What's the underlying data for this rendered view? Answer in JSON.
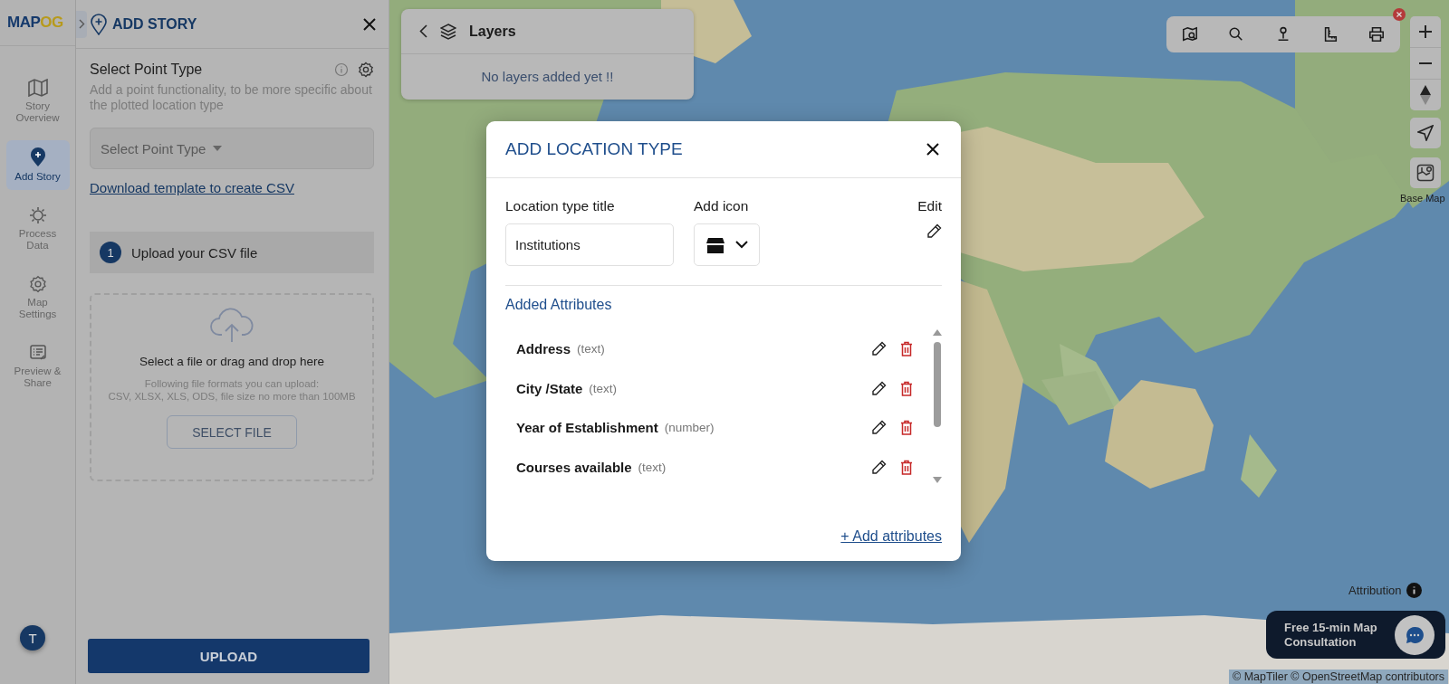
{
  "logo": {
    "text_1": "MAP",
    "text_2": "OG"
  },
  "nav": [
    {
      "kind": "map",
      "label": "Story Overview",
      "selected": false
    },
    {
      "kind": "pin",
      "label": "Add Story",
      "selected": true
    },
    {
      "kind": "gear-data",
      "label": "Process Data",
      "selected": false
    },
    {
      "kind": "settings",
      "label": "Map Settings",
      "selected": false
    },
    {
      "kind": "preview",
      "label": "Preview & Share",
      "selected": false
    }
  ],
  "avatar": "T",
  "panel": {
    "title": "ADD STORY",
    "section_title": "Select Point Type",
    "description": "Add a point functionality, to be more specific about the plotted location type",
    "select_placeholder": "Select Point Type",
    "template_link": "Download template to create CSV",
    "step": {
      "number": "1",
      "label": "Upload your CSV file"
    },
    "dropzone": {
      "title": "Select a file or drag and drop here",
      "hint_lines": [
        "Following file formats you can upload:",
        "CSV, XLSX, XLS, ODS, file size no more than 100MB"
      ],
      "button": "SELECT FILE"
    },
    "upload_button": "UPLOAD"
  },
  "layers": {
    "title": "Layers",
    "empty_message": "No layers added yet !!"
  },
  "base_map_label": "Base Map",
  "attribution": "Attribution",
  "consultation": "Free 15-min Map Consultation",
  "copyright": "© MapTiler © OpenStreetMap contributors",
  "modal": {
    "title": "ADD LOCATION TYPE",
    "title_label": "Location type title",
    "title_value": "Institutions",
    "icon_label": "Add icon",
    "edit_label": "Edit",
    "attributes_heading": "Added Attributes",
    "attributes": [
      {
        "name": "Address",
        "type": "(text)"
      },
      {
        "name": "City /State",
        "type": "(text)"
      },
      {
        "name": "Year of Establishment",
        "type": "(number)"
      },
      {
        "name": "Courses available",
        "type": "(text)"
      }
    ],
    "add_link": "+ Add attributes"
  }
}
